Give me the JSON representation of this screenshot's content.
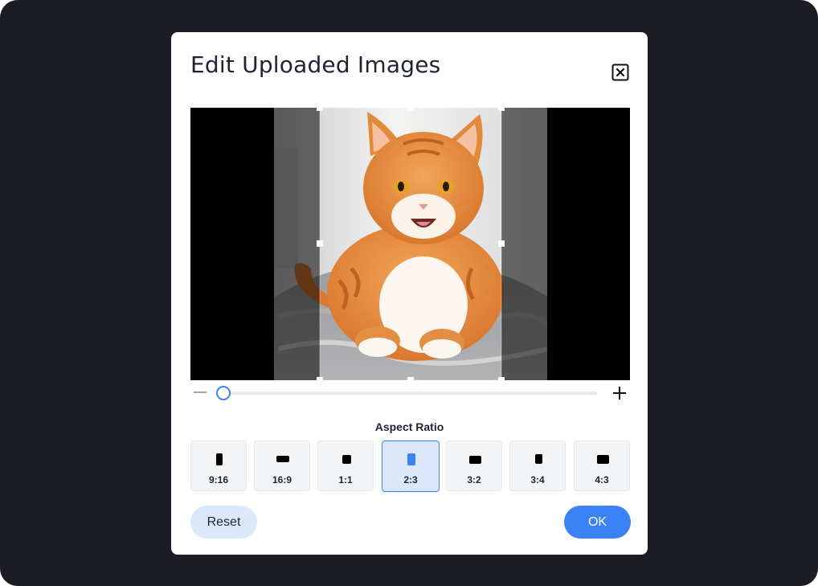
{
  "dialog": {
    "title": "Edit Uploaded Images",
    "close_icon": "close-icon"
  },
  "crop": {
    "image": "orange tabby cat lying on grey blanket",
    "selected_ratio": "2:3"
  },
  "zoom": {
    "minus_icon": "minus-icon",
    "plus_icon": "plus-icon",
    "level": 0.08
  },
  "aspect": {
    "label": "Aspect Ratio",
    "options": [
      {
        "label": "9:16",
        "selected": false
      },
      {
        "label": "16:9",
        "selected": false
      },
      {
        "label": "1:1",
        "selected": false
      },
      {
        "label": "2:3",
        "selected": true
      },
      {
        "label": "3:2",
        "selected": false
      },
      {
        "label": "3:4",
        "selected": false
      },
      {
        "label": "4:3",
        "selected": false
      }
    ]
  },
  "actions": {
    "reset_label": "Reset",
    "ok_label": "OK"
  },
  "colors": {
    "backdrop": "#1b1c24",
    "accent": "#3b82f6",
    "accent_light": "#dbe7fb"
  }
}
